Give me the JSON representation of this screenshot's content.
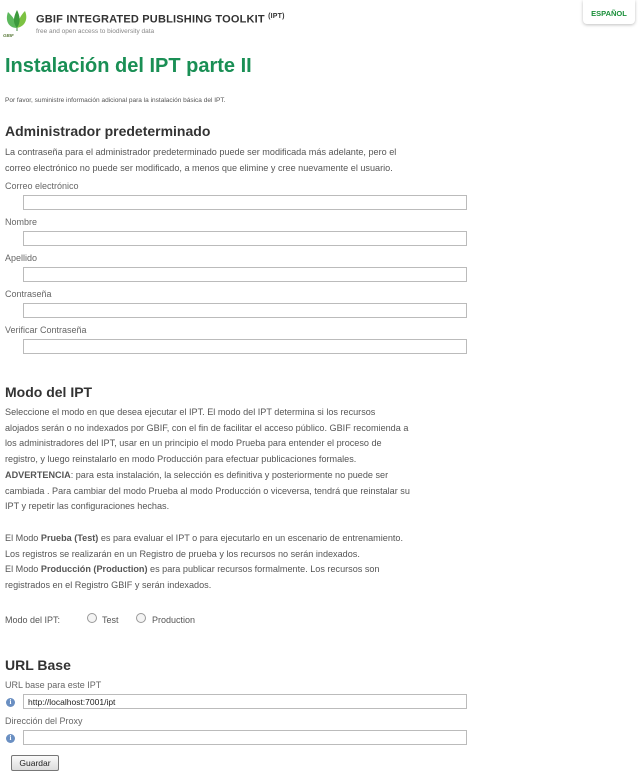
{
  "header": {
    "title": "GBIF INTEGRATED PUBLISHING TOOLKIT",
    "title_sup": "(IPT)",
    "tagline": "free and open access to biodiversity data",
    "logo_text": "GBIF",
    "language": "ESPAÑOL"
  },
  "page": {
    "title": "Instalación del IPT parte II",
    "intro": "Por favor, suministre información adicional para la instalación básica del IPT."
  },
  "admin": {
    "heading": "Administrador predeterminado",
    "desc_line1": "La contraseña para el administrador predeterminado puede ser modificada más adelante, pero el",
    "desc_line2": "correo electrónico no puede ser modificado, a menos que elimine y cree nuevamente el usuario.",
    "email_label": "Correo electrónico",
    "email_value": "",
    "name_label": "Nombre",
    "name_value": "",
    "lastname_label": "Apellido",
    "lastname_value": "",
    "password_label": "Contraseña",
    "password_value": "",
    "verify_label": "Verificar Contraseña",
    "verify_value": ""
  },
  "mode": {
    "heading": "Modo del IPT",
    "p1_l1": "Seleccione el modo en que desea ejecutar el IPT. El modo del IPT determina si los recursos",
    "p1_l2": "alojados serán o no indexados por GBIF, con el fin de facilitar el acceso público. GBIF recomienda a",
    "p1_l3": "los administradores del IPT, usar en un principio el modo Prueba para entender el proceso de",
    "p1_l4": "registro, y luego reinstalarlo en modo Producción para efectuar publicaciones formales.",
    "warning_bold": "ADVERTENCIA",
    "warning_rest": ": para esta instalación, la selección es definitiva y posteriormente no puede ser",
    "p1_l6": "cambiada . Para cambiar del modo Prueba al modo Producción o viceversa, tendrá que reinstalar su",
    "p1_l7": "IPT y repetir las configuraciones hechas.",
    "test_prefix": "El Modo ",
    "test_bold": "Prueba (Test)",
    "test_rest": " es para evaluar el IPT o para ejecutarlo en un escenario de entrenamiento.",
    "test_l2": "Los registros se realizarán en un Registro de prueba y los recursos no serán indexados.",
    "prod_prefix": "El Modo ",
    "prod_bold": "Producción (Production)",
    "prod_rest": " es para publicar recursos formalmente. Los recursos son",
    "prod_l2": "registrados en el Registro GBIF y serán indexados.",
    "selector_label": "Modo del IPT:",
    "option_test": "Test",
    "option_production": "Production"
  },
  "base": {
    "heading": "URL Base",
    "url_label": "URL base para este IPT",
    "url_value": "http://localhost:7001/ipt",
    "proxy_label": "Dirección del Proxy",
    "proxy_value": ""
  },
  "actions": {
    "save_label": "Guardar"
  },
  "colors": {
    "accent_green": "#1a8f55",
    "info_blue": "#6a8fc2"
  }
}
